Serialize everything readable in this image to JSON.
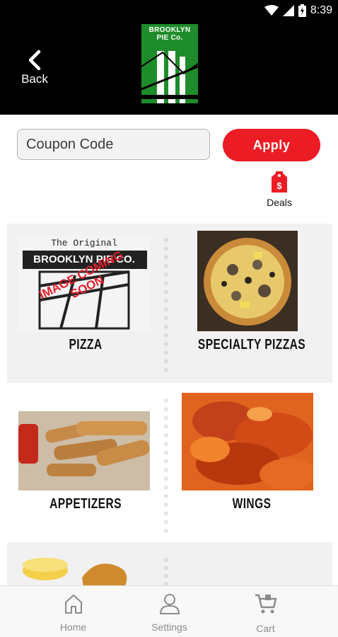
{
  "status_bar": {
    "time": "8:39"
  },
  "header": {
    "back_label": "Back",
    "logo_text_line1": "BROOKLYN",
    "logo_text_line2": "PIE Co."
  },
  "coupon": {
    "placeholder": "Coupon Code",
    "apply_label": "Apply"
  },
  "deals": {
    "label": "Deals",
    "icon": "price-tag-icon"
  },
  "categories": [
    {
      "label": "PIZZA",
      "image_text_line1": "The Original",
      "image_text_line2": "BROOKLYN PIE CO.",
      "image_stamp_line1": "IMAGE COMING",
      "image_stamp_line2": "SOON"
    },
    {
      "label": "SPECIALTY PIZZAS"
    },
    {
      "label": "APPETIZERS"
    },
    {
      "label": "WINGS"
    },
    {
      "label": ""
    },
    {
      "label": ""
    }
  ],
  "bottom_nav": [
    {
      "label": "Home",
      "icon": "home-icon"
    },
    {
      "label": "Settings",
      "icon": "user-icon"
    },
    {
      "label": "Cart",
      "icon": "cart-icon"
    }
  ],
  "colors": {
    "accent_red": "#ec1c24",
    "logo_green": "#1e8c2a",
    "header_bg": "#000000"
  }
}
